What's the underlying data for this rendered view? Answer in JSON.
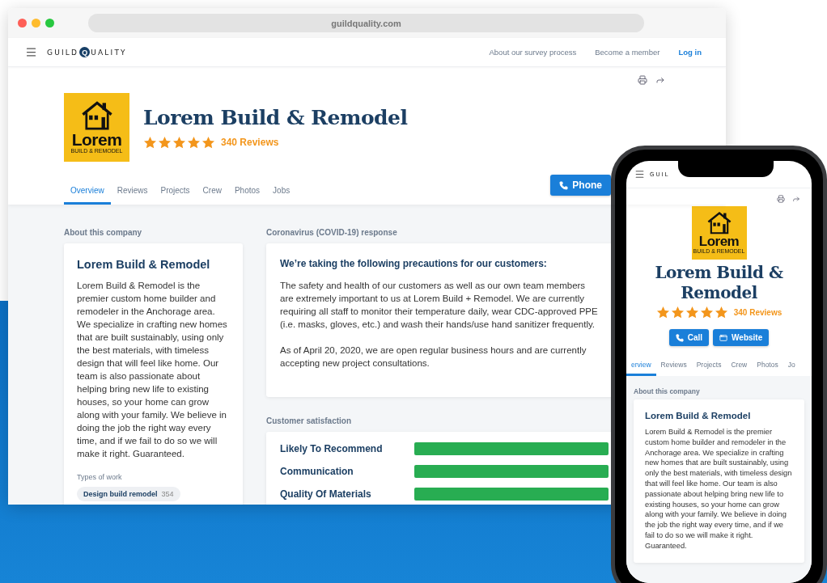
{
  "browser": {
    "url": "guildquality.com",
    "nav": {
      "logo": [
        "GUILD",
        "Q",
        "UALITY"
      ],
      "links": [
        {
          "label": "About our survey process",
          "kind": "plain"
        },
        {
          "label": "Become a member",
          "kind": "plain"
        },
        {
          "label": "Log in",
          "kind": "primary"
        }
      ]
    },
    "profile": {
      "logo": {
        "word": "Lorem",
        "sub": "BUILD & REMODEL"
      },
      "name": "Lorem Build & Remodel",
      "stars": 5,
      "reviews": "340 Reviews",
      "tabs": [
        {
          "label": "Overview",
          "selected": true
        },
        {
          "label": "Reviews",
          "selected": false
        },
        {
          "label": "Projects",
          "selected": false
        },
        {
          "label": "Crew",
          "selected": false
        },
        {
          "label": "Photos",
          "selected": false
        },
        {
          "label": "Jobs",
          "selected": false
        }
      ],
      "buttons": [
        {
          "label": "Phone",
          "kind": "phone"
        }
      ]
    },
    "about": {
      "heading": "About this company",
      "title": "Lorem Build & Remodel",
      "body": "Lorem Build & Remodel is the premier custom home builder and remodeler in the Anchorage area. We specialize in crafting new homes that are built sustainably, using only the best materials, with timeless design that will feel like home. Our team is also passionate about helping bring new life to existing houses, so your home can grow along with your family. We believe in doing the job the right way every time, and if we fail to do so we will make it right. Guaranteed.",
      "types_label": "Types of work",
      "tags": [
        {
          "label": "Design build remodel",
          "count": "354"
        }
      ]
    },
    "covid": {
      "heading": "Coronavirus (COVID-19) response",
      "title": "We’re taking the following precautions for our customers:",
      "paragraphs": [
        "The safety and health of our customers as well as our own team members are extremely important to us at Lorem Build + Remodel. We are currently requiring all staff to monitor their temperature daily, wear CDC-approved PPE (i.e. masks, gloves, etc.) and wash their hands/use hand sanitizer frequently.",
        "As of April 20, 2020, we are open regular business hours and are currently accepting new project consultations."
      ]
    },
    "satisfaction": {
      "heading": "Customer satisfaction",
      "metrics": [
        {
          "label": "Likely To Recommend",
          "level": 1
        },
        {
          "label": "Communication",
          "level": 1
        },
        {
          "label": "Quality Of Materials",
          "level": 1
        }
      ]
    }
  },
  "phone": {
    "logo": "GUIL",
    "profile": {
      "logo": {
        "word": "Lorem",
        "sub": "BUILD & REMODEL"
      },
      "name": "Lorem Build & Remodel",
      "stars": 5,
      "reviews": "340 Reviews",
      "buttons": [
        {
          "label": "Call",
          "kind": "phone"
        },
        {
          "label": "Website",
          "kind": "window"
        }
      ],
      "tabs": [
        {
          "label": "erview",
          "selected": true
        },
        {
          "label": "Reviews",
          "selected": false
        },
        {
          "label": "Projects",
          "selected": false
        },
        {
          "label": "Crew",
          "selected": false
        },
        {
          "label": "Photos",
          "selected": false
        },
        {
          "label": "Jo",
          "selected": false
        }
      ]
    },
    "about": {
      "heading": "About this company",
      "title": "Lorem Build & Remodel",
      "body": "Lorem Build & Remodel is the premier custom home builder and remodeler in the Anchorage area. We specialize in crafting new homes that are built sustainably, using only the best materials, with timeless design that will feel like home. Our team is also passionate about helping bring new life to existing houses, so your home can grow along with your family. We believe in doing the job the right way every time, and if we fail to do so we will make it right. Guaranteed."
    }
  }
}
